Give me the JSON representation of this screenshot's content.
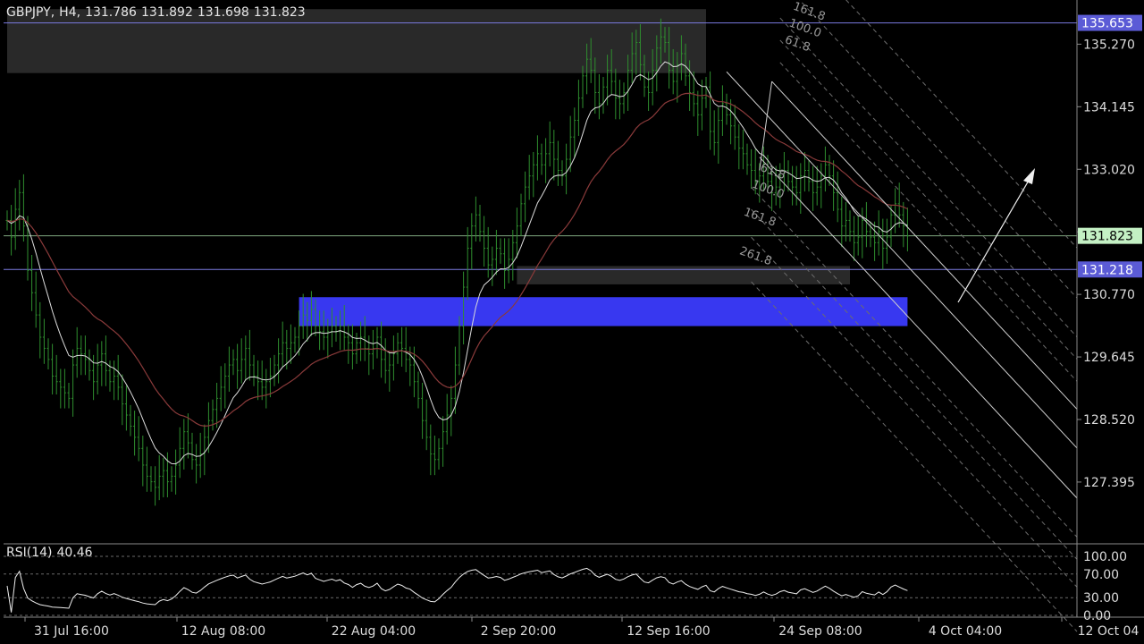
{
  "header": {
    "symbol": "GBPJPY,",
    "timeframe": "H4,",
    "open": "131.786",
    "high": "131.892",
    "low": "131.698",
    "close": "131.823"
  },
  "rsi": {
    "label": "RSI(14)",
    "value": "40.46",
    "levels": [
      70,
      30
    ],
    "axis_ticks": [
      "100.00",
      "70.00",
      "30.00",
      "0.00"
    ]
  },
  "colors": {
    "background": "#000000",
    "candle": "#2f8f2f",
    "ma_fast": "#dcdcdc",
    "ma_slow": "#8a3a3a",
    "zone": "#3838f0",
    "current_price": "#c4f0c4",
    "h_line": "#7a7ae0"
  },
  "chart_data": {
    "type": "candlestick",
    "symbol": "GBPJPY",
    "y_ticks": [
      135.27,
      134.145,
      133.02,
      131.895,
      130.77,
      129.645,
      128.52,
      127.395
    ],
    "y_tick_labels": [
      "135.270",
      "134.145",
      "133.020",
      "",
      "130.770",
      "129.645",
      "128.520",
      "127.395"
    ],
    "ylim": [
      126.3,
      136.0
    ],
    "x_labels": [
      "31 Jul 16:00",
      "12 Aug 08:00",
      "22 Aug 04:00",
      "2 Sep 20:00",
      "12 Sep 16:00",
      "24 Sep 08:00",
      "4 Oct 04:00",
      "12 Oct 04"
    ],
    "current_price": 131.823,
    "current_price_label": "131.823",
    "price_lines": [
      {
        "value": 135.653,
        "label": "135.653"
      },
      {
        "value": 131.218,
        "label": "131.218"
      }
    ],
    "zones": [
      {
        "kind": "supply",
        "from": 134.75,
        "to": 135.9,
        "start_idx": 0,
        "end_idx": 170
      },
      {
        "kind": "demand",
        "from": 130.2,
        "to": 130.72,
        "start_idx": 71,
        "end_idx": 219
      },
      {
        "kind": "gray",
        "from": 130.95,
        "to": 131.28,
        "start_idx": 124,
        "end_idx": 205
      }
    ],
    "fib_labels": [
      "161.8",
      "100.0",
      "61.8",
      "161.8",
      "261.8"
    ],
    "closes": [
      132.1,
      131.8,
      132.3,
      132.6,
      132.0,
      131.2,
      130.8,
      130.4,
      130.0,
      129.8,
      129.6,
      129.3,
      129.2,
      129.1,
      129.0,
      128.9,
      129.5,
      129.8,
      129.7,
      129.6,
      129.4,
      129.2,
      129.5,
      129.7,
      129.4,
      129.2,
      129.3,
      129.1,
      128.8,
      128.6,
      128.4,
      128.2,
      128.0,
      127.7,
      127.5,
      127.4,
      127.3,
      127.5,
      127.6,
      127.4,
      127.5,
      127.7,
      128.0,
      128.3,
      128.1,
      127.8,
      127.7,
      127.9,
      128.2,
      128.5,
      128.7,
      128.9,
      129.1,
      129.3,
      129.5,
      129.6,
      129.4,
      129.6,
      129.8,
      129.5,
      129.3,
      129.2,
      129.1,
      129.2,
      129.3,
      129.5,
      129.7,
      129.9,
      129.8,
      129.9,
      130.0,
      130.2,
      130.4,
      130.3,
      130.5,
      130.2,
      130.1,
      130.0,
      130.1,
      130.2,
      130.1,
      130.2,
      130.0,
      129.9,
      129.7,
      129.9,
      130.0,
      129.8,
      129.7,
      129.8,
      130.0,
      129.6,
      129.4,
      129.5,
      129.7,
      129.9,
      129.8,
      129.6,
      129.5,
      129.2,
      128.9,
      128.5,
      128.2,
      127.9,
      127.8,
      128.0,
      128.3,
      128.6,
      128.9,
      129.5,
      130.2,
      130.9,
      131.6,
      132.0,
      132.2,
      131.9,
      131.6,
      131.3,
      131.4,
      131.6,
      131.5,
      131.2,
      131.4,
      131.7,
      132.0,
      132.4,
      132.7,
      132.9,
      133.1,
      133.3,
      133.1,
      133.3,
      133.5,
      133.2,
      133.0,
      132.9,
      133.2,
      133.6,
      133.9,
      134.3,
      134.7,
      135.0,
      134.8,
      134.4,
      134.2,
      134.5,
      134.8,
      134.6,
      134.3,
      134.2,
      134.4,
      134.8,
      135.1,
      135.3,
      134.9,
      134.5,
      134.4,
      134.8,
      135.2,
      135.4,
      135.3,
      134.8,
      134.6,
      134.9,
      135.1,
      134.7,
      134.4,
      134.2,
      134.0,
      134.3,
      134.5,
      133.7,
      133.5,
      133.9,
      134.2,
      134.0,
      133.8,
      133.6,
      133.4,
      133.3,
      133.1,
      133.0,
      132.8,
      132.9,
      133.1,
      132.8,
      132.6,
      132.7,
      132.9,
      133.0,
      132.8,
      132.7,
      132.6,
      132.9,
      133.0,
      132.8,
      132.6,
      132.7,
      132.9,
      133.1,
      132.9,
      132.6,
      132.3,
      132.0,
      132.1,
      131.9,
      131.7,
      131.8,
      132.1,
      131.9,
      131.8,
      131.7,
      131.9,
      131.6,
      131.8,
      132.2,
      132.4,
      132.2,
      132.0,
      131.823
    ]
  }
}
